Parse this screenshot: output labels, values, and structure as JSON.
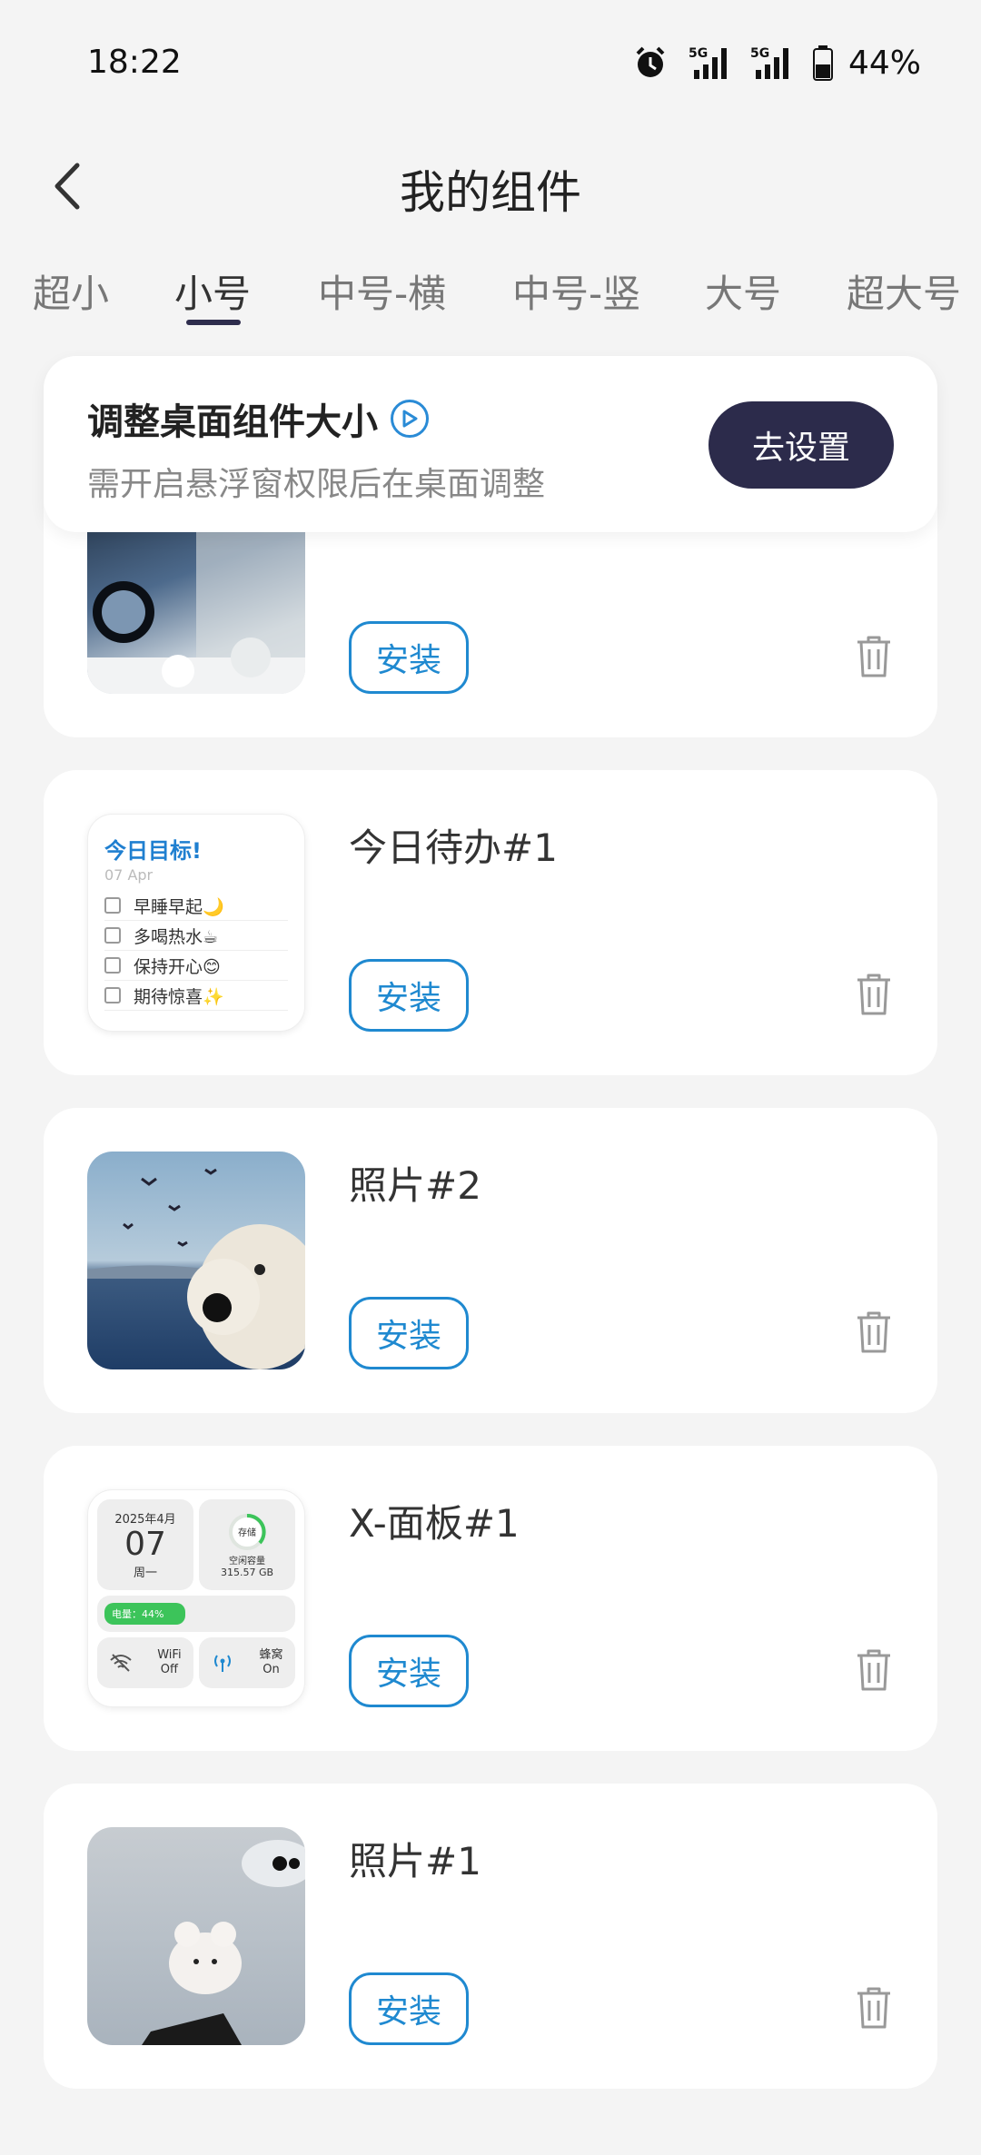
{
  "status": {
    "time": "18:22",
    "battery": "44%",
    "signal1": "5G",
    "signal2": "5G"
  },
  "header": {
    "title": "我的组件"
  },
  "tabs": [
    {
      "label": "超小"
    },
    {
      "label": "小号"
    },
    {
      "label": "中号-横"
    },
    {
      "label": "中号-竖"
    },
    {
      "label": "大号"
    },
    {
      "label": "超大号"
    }
  ],
  "banner": {
    "title": "调整桌面组件大小",
    "subtitle": "需开启悬浮窗权限后在桌面调整",
    "button": "去设置"
  },
  "cards": [
    {
      "title": "",
      "install": "安装"
    },
    {
      "title": "今日待办#1",
      "install": "安装"
    },
    {
      "title": "照片#2",
      "install": "安装"
    },
    {
      "title": "X-面板#1",
      "install": "安装"
    },
    {
      "title": "照片#1",
      "install": "安装"
    }
  ],
  "todo_widget": {
    "heading": "今日目标!",
    "date": "07 Apr",
    "items": [
      "早睡早起🌙",
      "多喝热水☕",
      "保持开心😊",
      "期待惊喜✨"
    ]
  },
  "xpanel_widget": {
    "month": "2025年4月",
    "day": "07",
    "weekday": "周一",
    "storage_label": "存储",
    "storage_sub": "空闲容量",
    "storage_value": "315.57 GB",
    "battery_label": "电量：44%",
    "battery_level": 0.44,
    "wifi_label": "WiFi",
    "wifi_state": "Off",
    "cell_label": "蜂窝",
    "cell_state": "On"
  },
  "colors": {
    "accent": "#1f89d0",
    "dark_button": "#2c2b4b",
    "background": "#f4f4f4"
  }
}
